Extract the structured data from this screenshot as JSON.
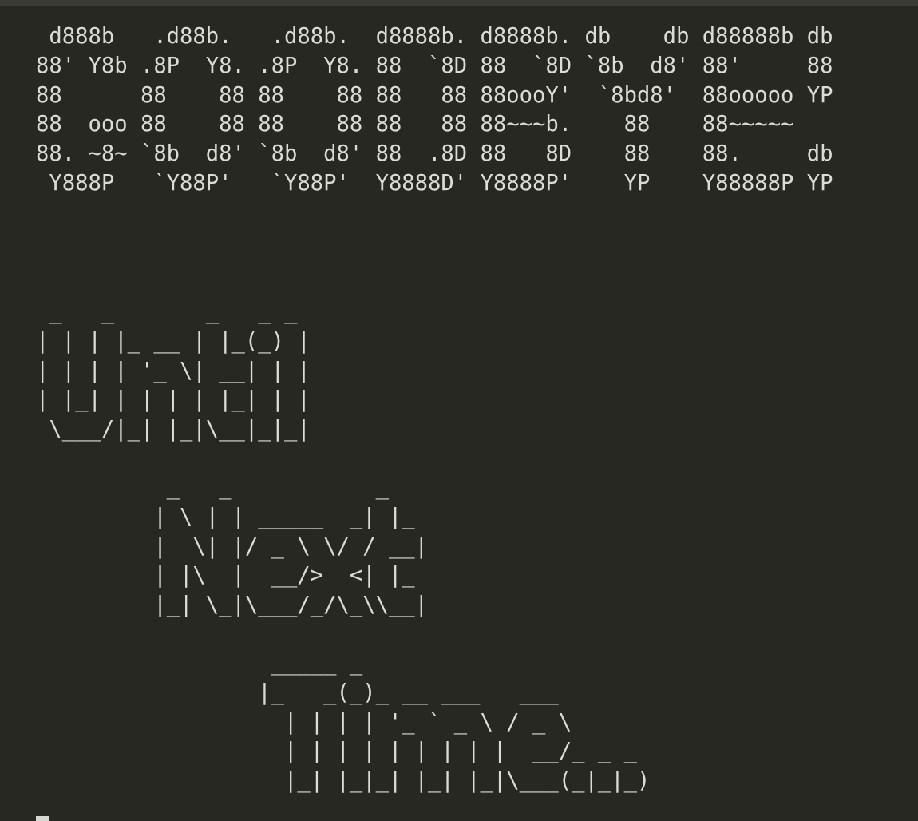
{
  "terminal": {
    "colors": {
      "background": "#272822",
      "foreground": "#dcdcd6"
    },
    "art": {
      "goodbye": [
        " d888b   .d88b.   .d88b.  d8888b. d8888b. db    db d88888b db",
        "88' Y8b .8P  Y8. .8P  Y8. 88  `8D 88  `8D `8b  d8' 88'     88",
        "88      88    88 88    88 88   88 88oooY'  `8bd8'  88ooooo YP",
        "88  ooo 88    88 88    88 88   88 88~~~b.    88    88~~~~~   ",
        "88. ~8~ `8b  d8' `8b  d8' 88  .8D 88   8D    88    88.     db",
        " Y888P   `Y88P'   `Y88P'  Y8888D' Y8888P'    YP    Y88888P YP"
      ],
      "until": [
        " _   _       _   _ _ ",
        "| | | |_ __ | |_(_) |",
        "| | | | '_ \\| __| | |",
        "| |_| | | | | |_| | |",
        " \\___/|_| |_|\\__|_|_|"
      ],
      "next": [
        "          _   _           _   ",
        "         | \\ | | _____  _| |_ ",
        "         |  \\| |/ _ \\ \\/ / __|",
        "         | |\\  |  __/>  <| |_ ",
        "         |_| \\_|\\___/_/\\_\\\\__|"
      ],
      "time": [
        "                  _____ _            ",
        "                 |_   _(_)_ __ ___   ___ ",
        "                   | | | | '_ ` _ \\ / _ \\",
        "                   | | | | | | | | |  __/_ _ _",
        "                   |_| |_|_| |_| |_|\\___(_|_|_)"
      ]
    }
  }
}
